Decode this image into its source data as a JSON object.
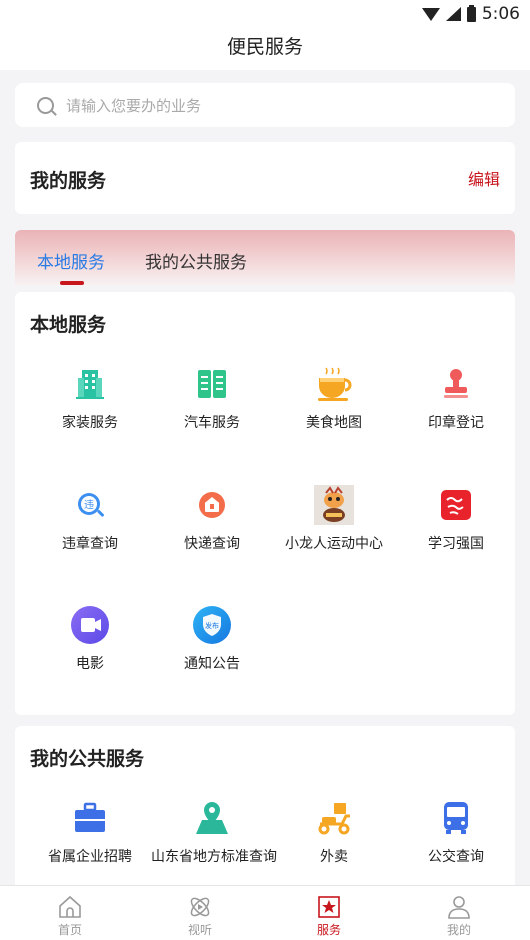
{
  "status_bar": {
    "time": "5:06"
  },
  "header": {
    "title": "便民服务"
  },
  "search": {
    "placeholder": "请输入您要办的业务"
  },
  "my_service": {
    "title": "我的服务",
    "edit_label": "编辑"
  },
  "tabs": [
    {
      "label": "本地服务",
      "active": true
    },
    {
      "label": "我的公共服务",
      "active": false
    }
  ],
  "local_services": {
    "title": "本地服务",
    "items": [
      {
        "label": "家装服务",
        "icon": "building-icon"
      },
      {
        "label": "汽车服务",
        "icon": "book-icon"
      },
      {
        "label": "美食地图",
        "icon": "coffee-cup-icon"
      },
      {
        "label": "印章登记",
        "icon": "stamp-icon"
      },
      {
        "label": "违章查询",
        "icon": "violation-search-icon"
      },
      {
        "label": "快递查询",
        "icon": "parcel-icon"
      },
      {
        "label": "小龙人运动中心",
        "icon": "mascot-image"
      },
      {
        "label": "学习强国",
        "icon": "xuexi-logo"
      },
      {
        "label": "电影",
        "icon": "video-icon"
      },
      {
        "label": "通知公告",
        "icon": "notice-shield-icon"
      }
    ]
  },
  "public_services": {
    "title": "我的公共服务",
    "items": [
      {
        "label": "省属企业招聘",
        "icon": "briefcase-icon"
      },
      {
        "label": "山东省地方标准查询",
        "icon": "map-pin-icon"
      },
      {
        "label": "外卖",
        "icon": "scooter-icon"
      },
      {
        "label": "公交查询",
        "icon": "bus-icon"
      }
    ]
  },
  "tabbar": [
    {
      "label": "首页",
      "icon": "home-icon",
      "active": false
    },
    {
      "label": "视听",
      "icon": "atom-icon",
      "active": false
    },
    {
      "label": "服务",
      "icon": "star-bookmark-icon",
      "active": true
    },
    {
      "label": "我的",
      "icon": "user-icon",
      "active": false
    }
  ],
  "colors": {
    "accent": "#c8161d",
    "tab_active": "#2b7be4",
    "background": "#f4f4f6"
  }
}
